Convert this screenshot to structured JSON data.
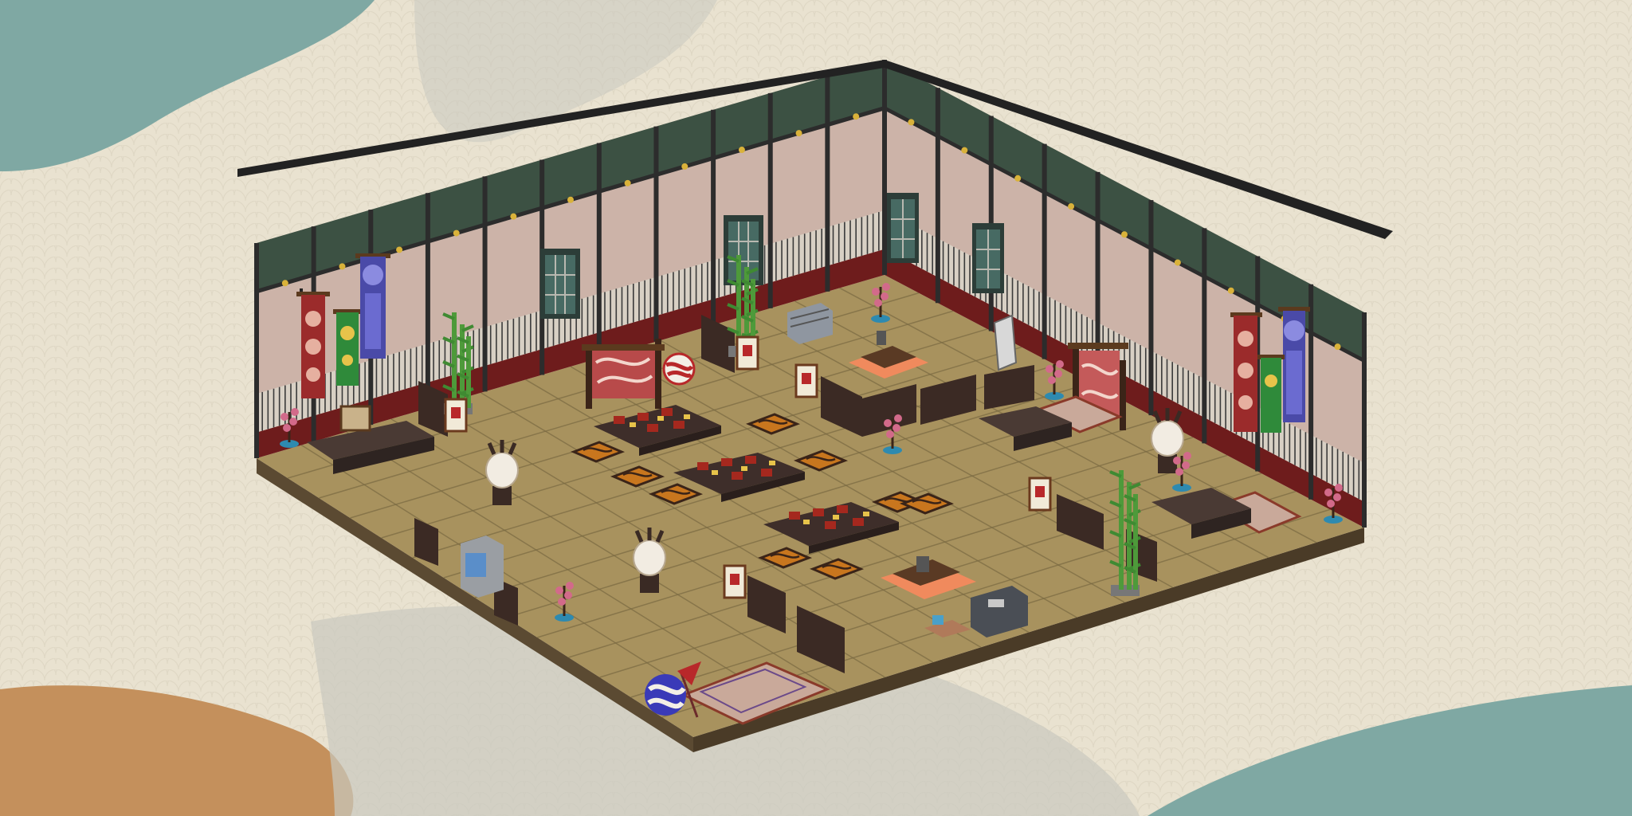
{
  "scene": {
    "kind": "isometric-room-showcase",
    "theme": "japanese-tatami-banquet-hall",
    "colors": {
      "background": "#e9e2d0",
      "blob_teal": "#7fa8a3",
      "blob_orange": "#c4905c",
      "blob_grey": "#c9c9bf",
      "floor": "#a8925e",
      "floor_line": "#7a6a42",
      "wall": "#ccb3a8",
      "wall_upper": "#3c5143",
      "frame": "#2c2c2c",
      "wainscot": "#6e1c1c",
      "lattice": "#d8d0c4",
      "table": "#3e2e2a",
      "cushion": "#c8761e",
      "lantern": "#f2ece2",
      "bamboo": "#4e9a3a"
    },
    "furniture_icons": [
      "tatami-floor",
      "hanging-scroll",
      "bamboo-plant",
      "lantern",
      "low-dining-table",
      "zabuton-cushion",
      "kotatsu",
      "folding-screen",
      "rug",
      "ball-ornament",
      "vending-machine",
      "stereo"
    ]
  }
}
